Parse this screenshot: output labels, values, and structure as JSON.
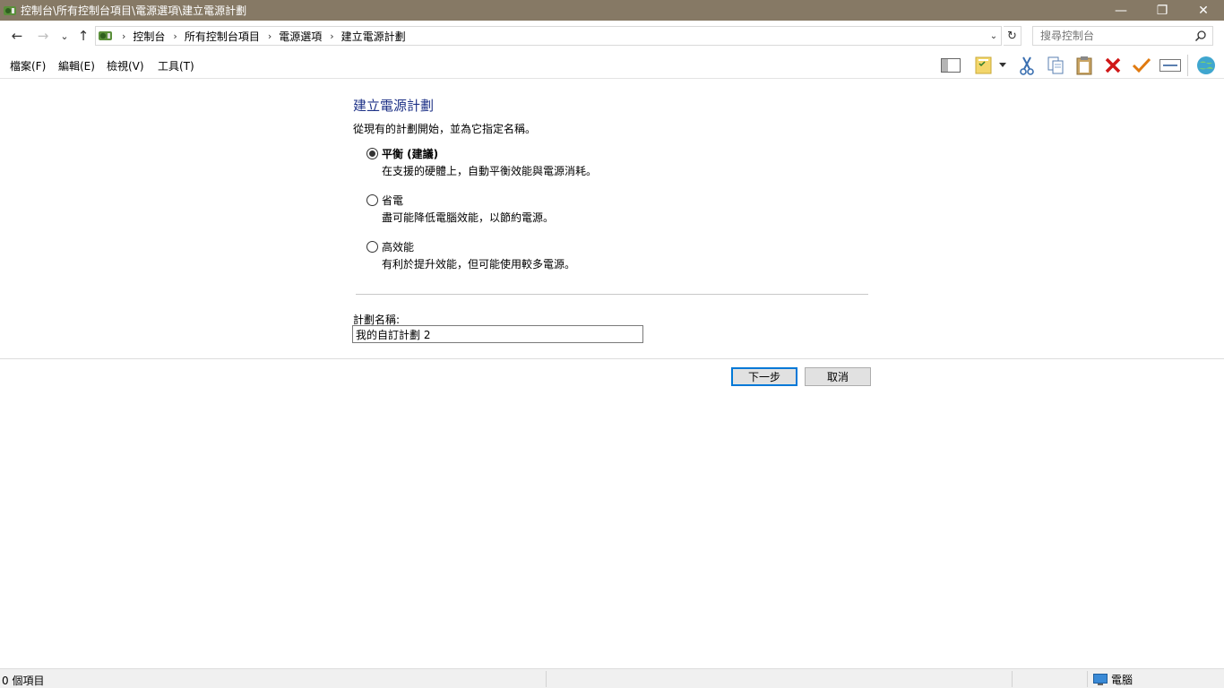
{
  "window": {
    "title": "控制台\\所有控制台項目\\電源選項\\建立電源計劃",
    "minimize": "—",
    "restore": "❐",
    "close": "✕"
  },
  "nav": {
    "back": "←",
    "forward": "→",
    "recent": "⌄",
    "up": "↑",
    "breadcrumbs": [
      "控制台",
      "所有控制台項目",
      "電源選項",
      "建立電源計劃"
    ],
    "separator": "›",
    "dropdown": "⌄",
    "refresh": "↻",
    "search_placeholder": "搜尋控制台"
  },
  "menu": {
    "file": "檔案(F)",
    "edit": "編輯(E)",
    "view": "檢視(V)",
    "tools": "工具(T)"
  },
  "toolbar": [
    "layout-pane-icon",
    "properties-icon",
    "cut-icon",
    "copy-icon",
    "paste-icon",
    "delete-icon",
    "checkmark-icon",
    "rename-icon",
    "globe-icon"
  ],
  "main": {
    "heading": "建立電源計劃",
    "intro": "從現有的計劃開始，並為它指定名稱。",
    "options": [
      {
        "label": "平衡 (建議)",
        "desc": "在支援的硬體上，自動平衡效能與電源消耗。",
        "checked": true
      },
      {
        "label": "省電",
        "desc": "盡可能降低電腦效能，以節約電源。",
        "checked": false
      },
      {
        "label": "高效能",
        "desc": "有利於提升效能，但可能使用較多電源。",
        "checked": false
      }
    ],
    "name_label": "計劃名稱:",
    "name_value": "我的自訂計劃 2",
    "next_button": "下一步",
    "cancel_button": "取消"
  },
  "status": {
    "count": "0 個項目",
    "zone": "電腦"
  },
  "colors": {
    "titlebar": "#867965",
    "heading": "#1e3287",
    "primary_border": "#0078d7"
  }
}
